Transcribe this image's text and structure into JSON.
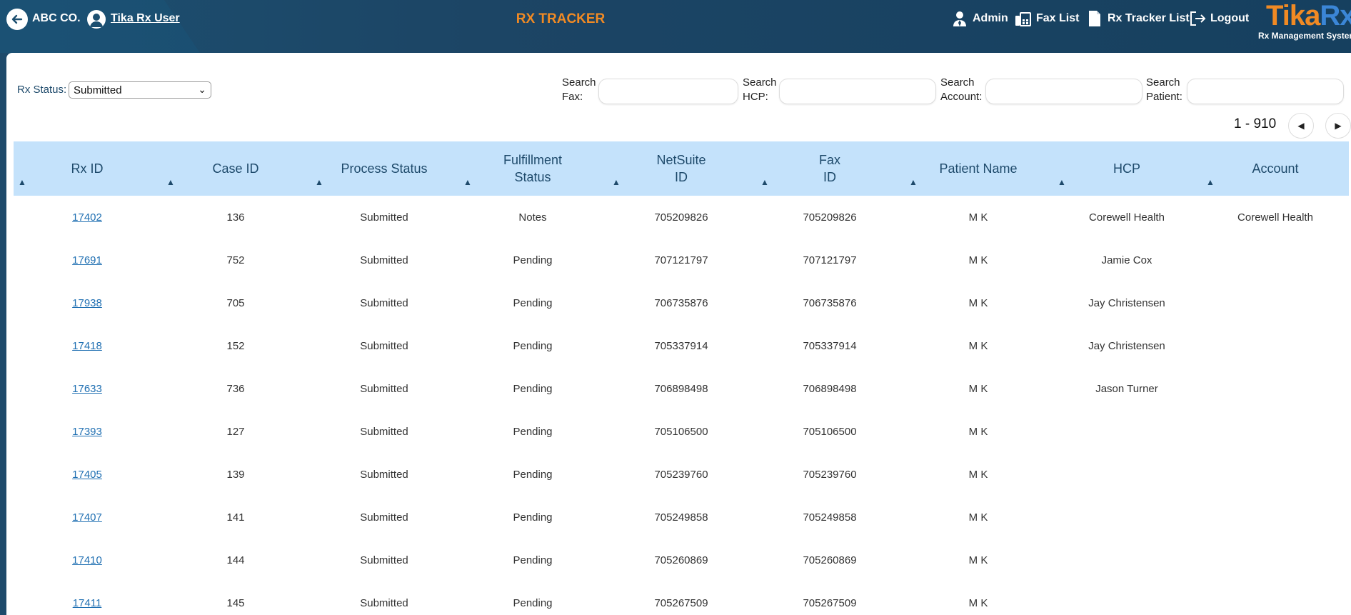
{
  "header": {
    "company": "ABC CO.",
    "user": "Tika Rx User",
    "title": "RX TRACKER",
    "nav": [
      {
        "label": "Admin",
        "icon": "admin-icon"
      },
      {
        "label": "Fax List",
        "icon": "fax-icon"
      },
      {
        "label": "Rx Tracker List",
        "icon": "document-icon"
      },
      {
        "label": "Logout",
        "icon": "logout-icon"
      }
    ],
    "logo_part1": "Tika",
    "logo_part2": "Rx",
    "logo_sub": "Rx Management System"
  },
  "filters": {
    "status_label": "Rx Status:",
    "status_value": "Submitted",
    "search_fax_label": "Search Fax:",
    "search_hcp_label": "Search HCP:",
    "search_account_label": "Search Account:",
    "search_patient_label": "Search Patient:"
  },
  "pager": {
    "range": "1 - 910"
  },
  "table": {
    "columns": [
      "Rx ID",
      "Case ID",
      "Process Status",
      "Fulfillment Status",
      "NetSuite ID",
      "Fax ID",
      "Patient Name",
      "HCP",
      "Account"
    ],
    "rows": [
      [
        "17402",
        "136",
        "Submitted",
        "Notes",
        "705209826",
        "705209826",
        "M K",
        "Corewell Health",
        "Corewell Health"
      ],
      [
        "17691",
        "752",
        "Submitted",
        "Pending",
        "707121797",
        "707121797",
        "M K",
        "Jamie Cox",
        ""
      ],
      [
        "17938",
        "705",
        "Submitted",
        "Pending",
        "706735876",
        "706735876",
        "M K",
        "Jay Christensen",
        ""
      ],
      [
        "17418",
        "152",
        "Submitted",
        "Pending",
        "705337914",
        "705337914",
        "M K",
        "Jay Christensen",
        ""
      ],
      [
        "17633",
        "736",
        "Submitted",
        "Pending",
        "706898498",
        "706898498",
        "M K",
        "Jason Turner",
        ""
      ],
      [
        "17393",
        "127",
        "Submitted",
        "Pending",
        "705106500",
        "705106500",
        "M K",
        "",
        ""
      ],
      [
        "17405",
        "139",
        "Submitted",
        "Pending",
        "705239760",
        "705239760",
        "M K",
        "",
        ""
      ],
      [
        "17407",
        "141",
        "Submitted",
        "Pending",
        "705249858",
        "705249858",
        "M K",
        "",
        ""
      ],
      [
        "17410",
        "144",
        "Submitted",
        "Pending",
        "705260869",
        "705260869",
        "M K",
        "",
        ""
      ],
      [
        "17411",
        "145",
        "Submitted",
        "Pending",
        "705267509",
        "705267509",
        "M K",
        "",
        ""
      ]
    ]
  },
  "colors": {
    "accent": "#f08a24",
    "header_bg": "#1c4565",
    "table_head": "#c4e2fb",
    "link": "#1f6fb2"
  }
}
